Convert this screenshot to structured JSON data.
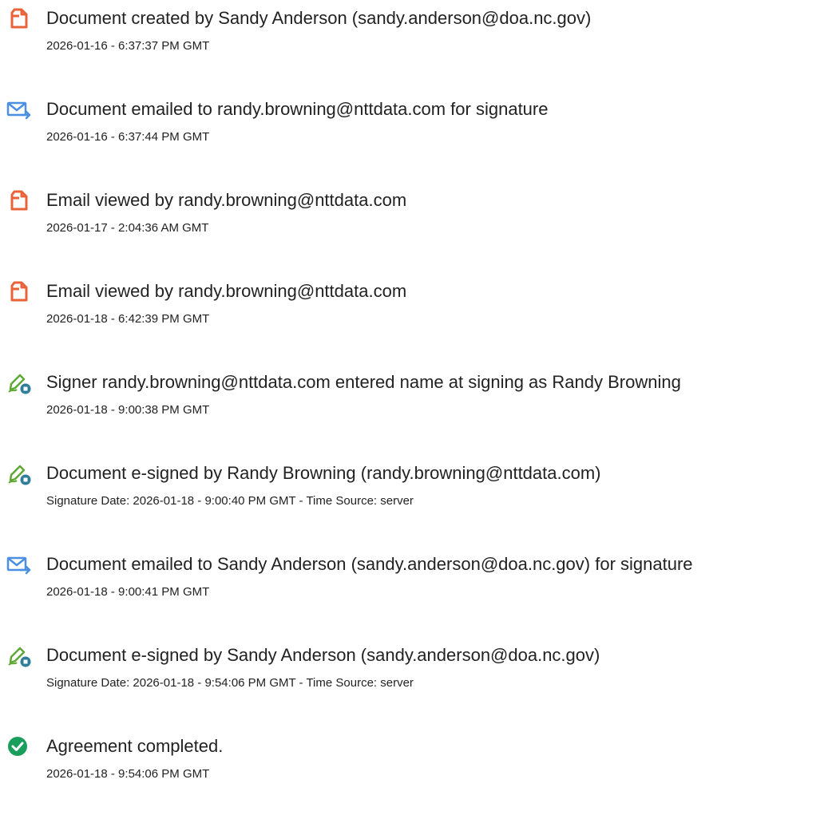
{
  "events": [
    {
      "icon": "document-created-icon",
      "title": "Document created by Sandy Anderson (sandy.anderson@doa.nc.gov)",
      "meta": "2026-01-16 - 6:37:37 PM GMT"
    },
    {
      "icon": "email-sent-icon",
      "title": "Document emailed to randy.browning@nttdata.com for signature",
      "meta": "2026-01-16 - 6:37:44 PM GMT"
    },
    {
      "icon": "document-viewed-icon",
      "title": "Email viewed by randy.browning@nttdata.com",
      "meta": "2026-01-17 - 2:04:36 AM GMT"
    },
    {
      "icon": "document-viewed-icon",
      "title": "Email viewed by randy.browning@nttdata.com",
      "meta": "2026-01-18 - 6:42:39 PM GMT"
    },
    {
      "icon": "e-sign-pen-icon",
      "title": "Signer randy.browning@nttdata.com entered name at signing as Randy Browning",
      "meta": "2026-01-18 - 9:00:38 PM GMT"
    },
    {
      "icon": "e-sign-pen-icon",
      "title": "Document e-signed by Randy Browning (randy.browning@nttdata.com)",
      "meta": "Signature Date: 2026-01-18 - 9:00:40 PM GMT - Time Source: server"
    },
    {
      "icon": "email-sent-icon",
      "title": "Document emailed to Sandy Anderson (sandy.anderson@doa.nc.gov) for signature",
      "meta": "2026-01-18 - 9:00:41 PM GMT"
    },
    {
      "icon": "e-sign-pen-icon",
      "title": "Document e-signed by Sandy Anderson (sandy.anderson@doa.nc.gov)",
      "meta": "Signature Date: 2026-01-18 - 9:54:06 PM GMT - Time Source: server"
    },
    {
      "icon": "check-circle-icon",
      "title": "Agreement completed.",
      "meta": "2026-01-18 - 9:54:06 PM GMT"
    }
  ],
  "colors": {
    "document_icon": "#E8633A",
    "email_icon": "#4A90E2",
    "sign_icon_pen": "#5FA836",
    "sign_icon_badge": "#2E7D9A",
    "check_icon": "#1A9E5C",
    "text": "#222222"
  }
}
